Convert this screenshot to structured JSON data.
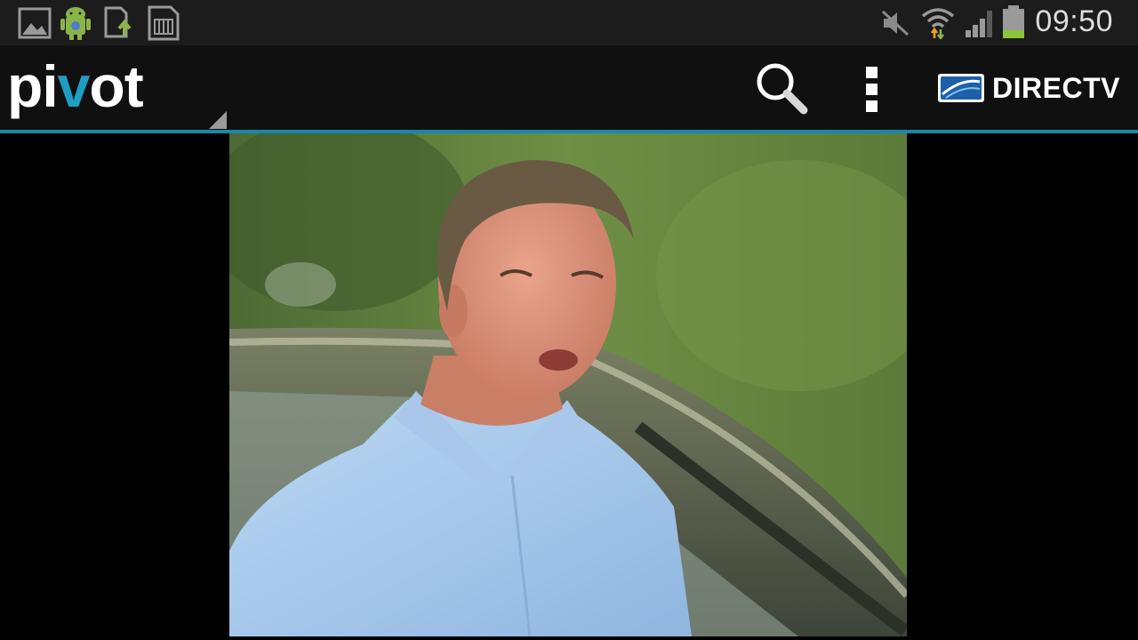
{
  "status_bar": {
    "time": "09:50",
    "notification_icons": [
      "gallery-icon",
      "android-icon",
      "sd-upload-icon",
      "sd-card-icon"
    ],
    "system_icons": [
      "mute-icon",
      "wifi-icon",
      "signal-icon",
      "battery-icon"
    ]
  },
  "action_bar": {
    "brand_prefix": "pi",
    "brand_v": "v",
    "brand_suffix": "ot",
    "search_icon": "search-icon",
    "menu_icon": "overflow-menu-icon",
    "partner_logo_text": "DIRECTV",
    "accent_color": "#1b87a8"
  },
  "content": {
    "media": "video-frame"
  }
}
